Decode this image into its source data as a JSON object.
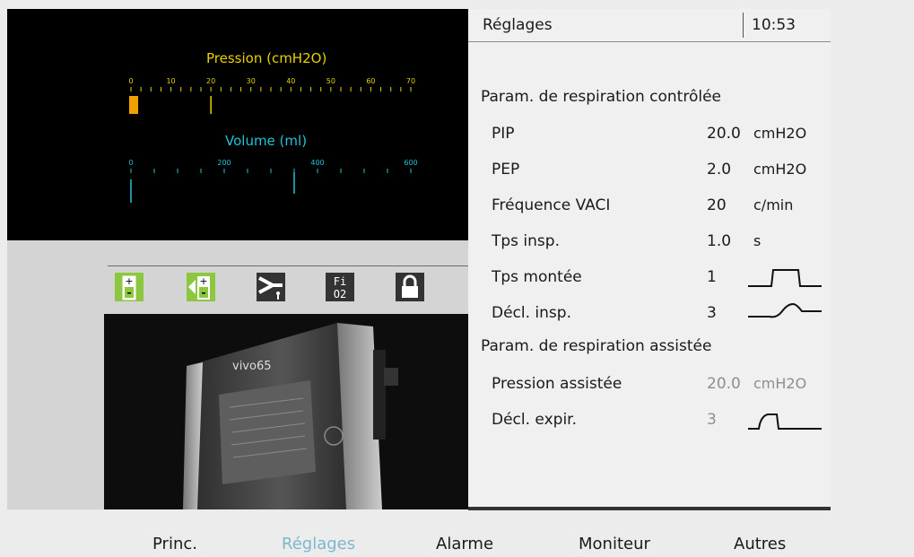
{
  "monitor": {
    "pressure": {
      "title": "Pression (cmH2O)",
      "tick_labels": [
        "0",
        "10",
        "20",
        "30",
        "40",
        "50",
        "60",
        "70"
      ],
      "current_value": 2,
      "set_value": 20,
      "scale_max": 70
    },
    "volume": {
      "title": "Volume (ml)",
      "tick_labels": [
        "0",
        "200",
        "400",
        "600"
      ],
      "current_value": 0,
      "set_value": 350,
      "scale_max": 600
    }
  },
  "status_icons": [
    "internal-battery-icon",
    "external-battery-icon",
    "patient-circuit-icon",
    "fio2-icon",
    "lock-icon"
  ],
  "fio2_label": {
    "top": "Fi",
    "bottom": "O2"
  },
  "device": {
    "brand": "vivo65"
  },
  "header": {
    "title": "Réglages",
    "time": "10:53"
  },
  "controlled": {
    "section_title": "Param. de respiration contrôlée",
    "params": [
      {
        "label": "PIP",
        "value": "20.0",
        "unit": "cmH2O"
      },
      {
        "label": "PEP",
        "value": "2.0",
        "unit": "cmH2O"
      },
      {
        "label": "Fréquence VACI",
        "value": "20",
        "unit": "c/min"
      },
      {
        "label": "Tps insp.",
        "value": "1.0",
        "unit": "s"
      },
      {
        "label": "Tps montée",
        "value": "1",
        "unit_icon": "rise-time-icon"
      },
      {
        "label": "Décl. insp.",
        "value": "3",
        "unit_icon": "insp-trigger-icon"
      }
    ]
  },
  "assisted": {
    "section_title": "Param. de respiration assistée",
    "params": [
      {
        "label": "Pression assistée",
        "value": "20.0",
        "unit": "cmH2O"
      },
      {
        "label": "Décl. expir.",
        "value": "3",
        "unit_icon": "exp-trigger-icon"
      }
    ]
  },
  "tabs": [
    {
      "label": "Princ.",
      "active": false
    },
    {
      "label": "Réglages",
      "active": true
    },
    {
      "label": "Alarme",
      "active": false
    },
    {
      "label": "Moniteur",
      "active": false
    },
    {
      "label": "Autres",
      "active": false
    }
  ],
  "colors": {
    "pressure": "#e6d200",
    "pressure_bar": "#f0a000",
    "volume": "#22c3d6",
    "icon_green": "#8dc63f",
    "active_tab": "#7bb8c9"
  }
}
